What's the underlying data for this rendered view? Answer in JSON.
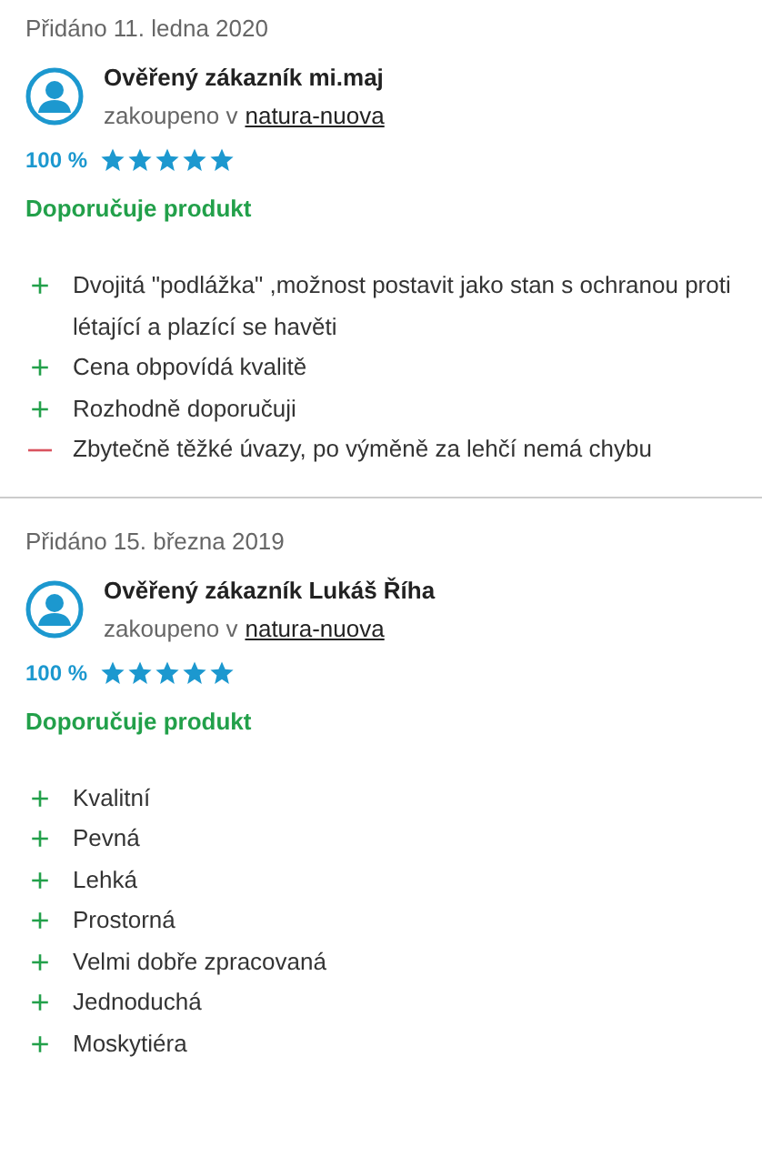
{
  "reviews": [
    {
      "date": "Přidáno 11. ledna 2020",
      "author": "Ověřený zákazník mi.maj",
      "purchased_prefix": "zakoupeno v",
      "shop": "natura-nuova",
      "rating_text": "100 %",
      "stars": 5,
      "recommendation": "Doporučuje produkt",
      "points": [
        {
          "kind": "pro",
          "sign": "+",
          "text": "Dvojitá \"podlážka\" ,možnost postavit jako stan s ochranou proti létající a plazící se havěti"
        },
        {
          "kind": "pro",
          "sign": "+",
          "text": "Cena obpovídá kvalitě"
        },
        {
          "kind": "pro",
          "sign": "+",
          "text": "Rozhodně doporučuji"
        },
        {
          "kind": "con",
          "sign": "—",
          "text": "Zbytečně těžké úvazy, po výměně za lehčí nemá chybu"
        }
      ]
    },
    {
      "date": "Přidáno 15. března 2019",
      "author": "Ověřený zákazník Lukáš Říha",
      "purchased_prefix": "zakoupeno v",
      "shop": "natura-nuova",
      "rating_text": "100 %",
      "stars": 5,
      "recommendation": "Doporučuje produkt",
      "points": [
        {
          "kind": "pro",
          "sign": "+",
          "text": "Kvalitní"
        },
        {
          "kind": "pro",
          "sign": "+",
          "text": "Pevná"
        },
        {
          "kind": "pro",
          "sign": "+",
          "text": "Lehká"
        },
        {
          "kind": "pro",
          "sign": "+",
          "text": "Prostorná"
        },
        {
          "kind": "pro",
          "sign": "+",
          "text": "Velmi dobře zpracovaná"
        },
        {
          "kind": "pro",
          "sign": "+",
          "text": "Jednoduchá"
        },
        {
          "kind": "pro",
          "sign": "+",
          "text": "Moskytiéra"
        }
      ]
    }
  ]
}
